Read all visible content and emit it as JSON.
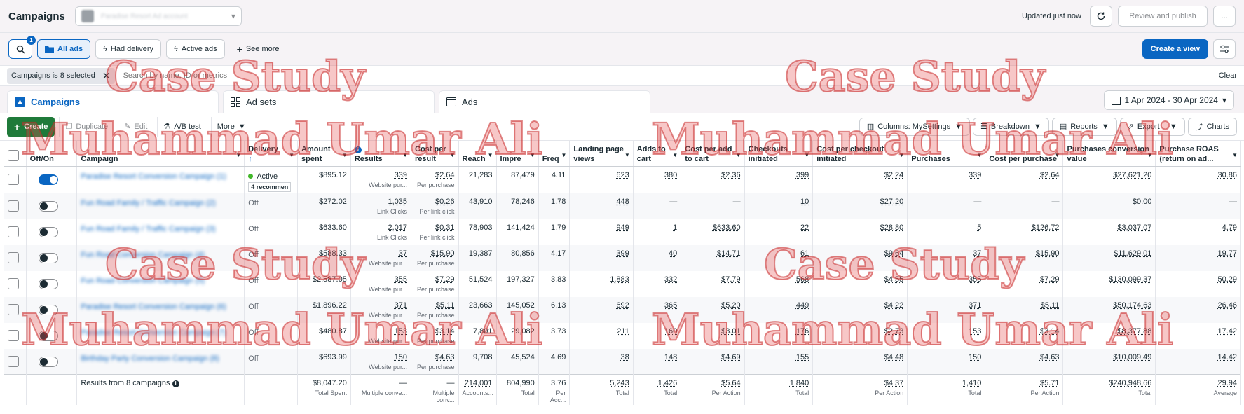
{
  "header": {
    "title": "Campaigns",
    "account_name": "Paradise Resort Ad account",
    "updated": "Updated just now",
    "review_label": "Review and publish",
    "more_label": "..."
  },
  "filters": {
    "search_badge": "1",
    "chips": [
      "All ads",
      "Had delivery",
      "Active ads",
      "See more"
    ],
    "create_view": "Create a view"
  },
  "search": {
    "pill": "Campaigns is 8 selected",
    "placeholder": "Search by name, ID or metrics",
    "clear": "Clear"
  },
  "tabs": [
    "Campaigns",
    "Ad sets",
    "Ads"
  ],
  "date_range": "1 Apr 2024 - 30 Apr 2024",
  "toolbar": {
    "create": "Create",
    "duplicate": "Duplicate",
    "edit": "Edit",
    "ab_test": "A/B test",
    "more": "More",
    "columns": "Columns: MySettings",
    "breakdown": "Breakdown",
    "reports": "Reports",
    "export": "Export",
    "charts": "Charts"
  },
  "table": {
    "headers": [
      "Off/On",
      "Campaign",
      "Delivery",
      "Amount spent",
      "Results",
      "Cost per result",
      "Reach",
      "Impre",
      "Freq",
      "Landing page views",
      "Adds to cart",
      "Cost per add to cart",
      "Checkouts initiated",
      "Cost per checkout initiated",
      "Purchases",
      "Cost per purchase",
      "Purchases conversion value",
      "Purchase ROAS (return on ad..."
    ],
    "rows": [
      {
        "on": true,
        "name": "Paradise Resort Conversion Campaign (1)",
        "delivery": "Active",
        "recommend": "4 recommen",
        "spent": "$895.12",
        "results": "339",
        "results_sub": "Website pur...",
        "cpr": "$2.64",
        "cpr_sub": "Per purchase",
        "reach": "21,283",
        "impr": "87,479",
        "freq": "4.11",
        "lpv": "623",
        "atc": "380",
        "cpatc": "$2.36",
        "checkouts": "399",
        "cpco": "$2.24",
        "purchases": "339",
        "cpp": "$2.64",
        "value": "$27,621.20",
        "roas": "30.86"
      },
      {
        "on": false,
        "name": "Fun Road Family / Traffic Campaign (2)",
        "delivery": "Off",
        "recommend": "",
        "spent": "$272.02",
        "results": "1,035",
        "results_sub": "Link Clicks",
        "cpr": "$0.26",
        "cpr_sub": "Per link click",
        "reach": "43,910",
        "impr": "78,246",
        "freq": "1.78",
        "lpv": "448",
        "atc": "—",
        "cpatc": "—",
        "checkouts": "10",
        "cpco": "$27.20",
        "purchases": "—",
        "cpp": "—",
        "value": "$0.00",
        "roas": "—"
      },
      {
        "on": false,
        "name": "Fun Road Family / Traffic Campaign (3)",
        "delivery": "Off",
        "recommend": "",
        "spent": "$633.60",
        "results": "2,017",
        "results_sub": "Link Clicks",
        "cpr": "$0.31",
        "cpr_sub": "Per link click",
        "reach": "78,903",
        "impr": "141,424",
        "freq": "1.79",
        "lpv": "949",
        "atc": "1",
        "cpatc": "$633.60",
        "checkouts": "22",
        "cpco": "$28.80",
        "purchases": "5",
        "cpp": "$126.72",
        "value": "$3,037.07",
        "roas": "4.79"
      },
      {
        "on": false,
        "name": "Fun Road Conversion Campaign (4)",
        "delivery": "Off",
        "recommend": "",
        "spent": "$588.33",
        "results": "37",
        "results_sub": "Website pur...",
        "cpr": "$15.90",
        "cpr_sub": "Per purchase",
        "reach": "19,387",
        "impr": "80,856",
        "freq": "4.17",
        "lpv": "399",
        "atc": "40",
        "cpatc": "$14.71",
        "checkouts": "61",
        "cpco": "$9.64",
        "purchases": "37",
        "cpp": "$15.90",
        "value": "$11,629.01",
        "roas": "19.77"
      },
      {
        "on": false,
        "name": "Fun Road Conversion Campaign (5)",
        "delivery": "Off",
        "recommend": "",
        "spent": "$2,587.05",
        "results": "355",
        "results_sub": "Website pur...",
        "cpr": "$7.29",
        "cpr_sub": "Per purchase",
        "reach": "51,524",
        "impr": "197,327",
        "freq": "3.83",
        "lpv": "1,883",
        "atc": "332",
        "cpatc": "$7.79",
        "checkouts": "568",
        "cpco": "$4.55",
        "purchases": "355",
        "cpp": "$7.29",
        "value": "$130,099.37",
        "roas": "50.29"
      },
      {
        "on": false,
        "name": "Paradise Resort Conversion Campaign (6)",
        "delivery": "Off",
        "recommend": "",
        "spent": "$1,896.22",
        "results": "371",
        "results_sub": "Website pur...",
        "cpr": "$5.11",
        "cpr_sub": "Per purchase",
        "reach": "23,663",
        "impr": "145,052",
        "freq": "6.13",
        "lpv": "692",
        "atc": "365",
        "cpatc": "$5.20",
        "checkouts": "449",
        "cpco": "$4.22",
        "purchases": "371",
        "cpp": "$5.11",
        "value": "$50,174.63",
        "roas": "26.46"
      },
      {
        "on": false,
        "name": "Paradise Resort Conversion Campaign (7)",
        "delivery": "Off",
        "recommend": "",
        "spent": "$480.87",
        "results": "153",
        "results_sub": "Website pur...",
        "cpr": "$3.14",
        "cpr_sub": "Per purchase",
        "reach": "7,801",
        "impr": "29,082",
        "freq": "3.73",
        "lpv": "211",
        "atc": "160",
        "cpatc": "$3.01",
        "checkouts": "176",
        "cpco": "$2.73",
        "purchases": "153",
        "cpp": "$3.14",
        "value": "$8,377.88",
        "roas": "17.42"
      },
      {
        "on": false,
        "name": "Birthday Party Conversion Campaign (8)",
        "delivery": "Off",
        "recommend": "",
        "spent": "$693.99",
        "results": "150",
        "results_sub": "Website pur...",
        "cpr": "$4.63",
        "cpr_sub": "Per purchase",
        "reach": "9,708",
        "impr": "45,524",
        "freq": "4.69",
        "lpv": "38",
        "atc": "148",
        "cpatc": "$4.69",
        "checkouts": "155",
        "cpco": "$4.48",
        "purchases": "150",
        "cpp": "$4.63",
        "value": "$10,009.49",
        "roas": "14.42"
      }
    ],
    "footer": {
      "label": "Results from 8 campaigns",
      "spent": "$8,047.20",
      "spent_sub": "Total Spent",
      "results": "—",
      "results_sub": "Multiple conve...",
      "cpr": "—",
      "cpr_sub": "Multiple conv...",
      "reach": "214,001",
      "reach_sub": "Accounts...",
      "impr": "804,990",
      "impr_sub": "Total",
      "freq": "3.76",
      "freq_sub": "Per Acc...",
      "lpv": "5,243",
      "lpv_sub": "Total",
      "atc": "1,426",
      "atc_sub": "Total",
      "cpatc": "$5.64",
      "cpatc_sub": "Per Action",
      "checkouts": "1,840",
      "checkouts_sub": "Total",
      "cpco": "$4.37",
      "cpco_sub": "Per Action",
      "purchases": "1,410",
      "purchases_sub": "Total",
      "cpp": "$5.71",
      "cpp_sub": "Per Action",
      "value": "$240,948.66",
      "value_sub": "Total",
      "roas": "29.94",
      "roas_sub": "Average"
    }
  },
  "watermark": {
    "line1": "Case Study",
    "line2": "Muhammad Umar Ali",
    "color": "#e05050"
  }
}
